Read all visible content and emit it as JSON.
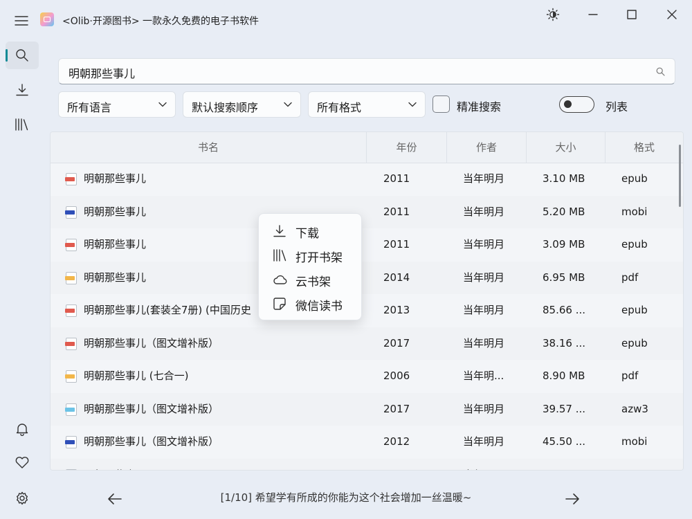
{
  "window": {
    "title": "<Olib·开源图书> 一款永久免费的电子书软件"
  },
  "search": {
    "value": "明朝那些事儿"
  },
  "filters": {
    "language": "所有语言",
    "order": "默认搜索顺序",
    "format": "所有格式",
    "exact_label": "精准搜索",
    "exact_checked": false,
    "view_label": "列表",
    "view_toggle_on": false
  },
  "table": {
    "headers": [
      "书名",
      "年份",
      "作者",
      "大小",
      "格式"
    ],
    "rows": [
      {
        "name": "明朝那些事儿",
        "year": "2011",
        "author": "当年明月",
        "size": "3.10 MB",
        "format": "epub",
        "tag_color": "#e05a4e"
      },
      {
        "name": "明朝那些事儿",
        "year": "2011",
        "author": "当年明月",
        "size": "5.20 MB",
        "format": "mobi",
        "tag_color": "#2f4fb8"
      },
      {
        "name": "明朝那些事儿",
        "year": "2011",
        "author": "当年明月",
        "size": "3.09 MB",
        "format": "epub",
        "tag_color": "#e05a4e"
      },
      {
        "name": "明朝那些事儿",
        "year": "2014",
        "author": "当年明月",
        "size": "6.95 MB",
        "format": "pdf",
        "tag_color": "#f2b64a"
      },
      {
        "name": "明朝那些事儿(套装全7册) (中国历史",
        "year": "2013",
        "author": "当年明月",
        "size": "85.66 ...",
        "format": "epub",
        "tag_color": "#e05a4e"
      },
      {
        "name": "明朝那些事儿（图文增补版）",
        "year": "2017",
        "author": "当年明月",
        "size": "38.16 ...",
        "format": "epub",
        "tag_color": "#e05a4e"
      },
      {
        "name": "明朝那些事儿 (七合一)",
        "year": "2006",
        "author": "当年明...",
        "size": "8.90 MB",
        "format": "pdf",
        "tag_color": "#f2b64a"
      },
      {
        "name": "明朝那些事儿（图文增补版）",
        "year": "2017",
        "author": "当年明月",
        "size": "39.57 ...",
        "format": "azw3",
        "tag_color": "#6cc3e6"
      },
      {
        "name": "明朝那些事儿（图文增补版）",
        "year": "2012",
        "author": "当年明月",
        "size": "45.50 ...",
        "format": "mobi",
        "tag_color": "#2f4fb8"
      },
      {
        "name": "明朝那些事儿",
        "year": "",
        "author": "当年明月",
        "size": "",
        "format": "",
        "tag_color": "#f2b64a"
      }
    ]
  },
  "context_menu": {
    "items": [
      {
        "label": "下载",
        "icon": "download-icon"
      },
      {
        "label": "打开书架",
        "icon": "bookshelf-icon"
      },
      {
        "label": "云书架",
        "icon": "cloud-icon"
      },
      {
        "label": "微信读书",
        "icon": "wechat-read-icon"
      }
    ]
  },
  "footer": {
    "page_text": "[1/10] 希望学有所成的你能为这个社会增加一丝温暖~"
  },
  "nav": {
    "top": [
      "search-icon",
      "download-icon",
      "library-icon"
    ],
    "bottom": [
      "bell-icon",
      "heart-icon",
      "settings-icon"
    ]
  }
}
